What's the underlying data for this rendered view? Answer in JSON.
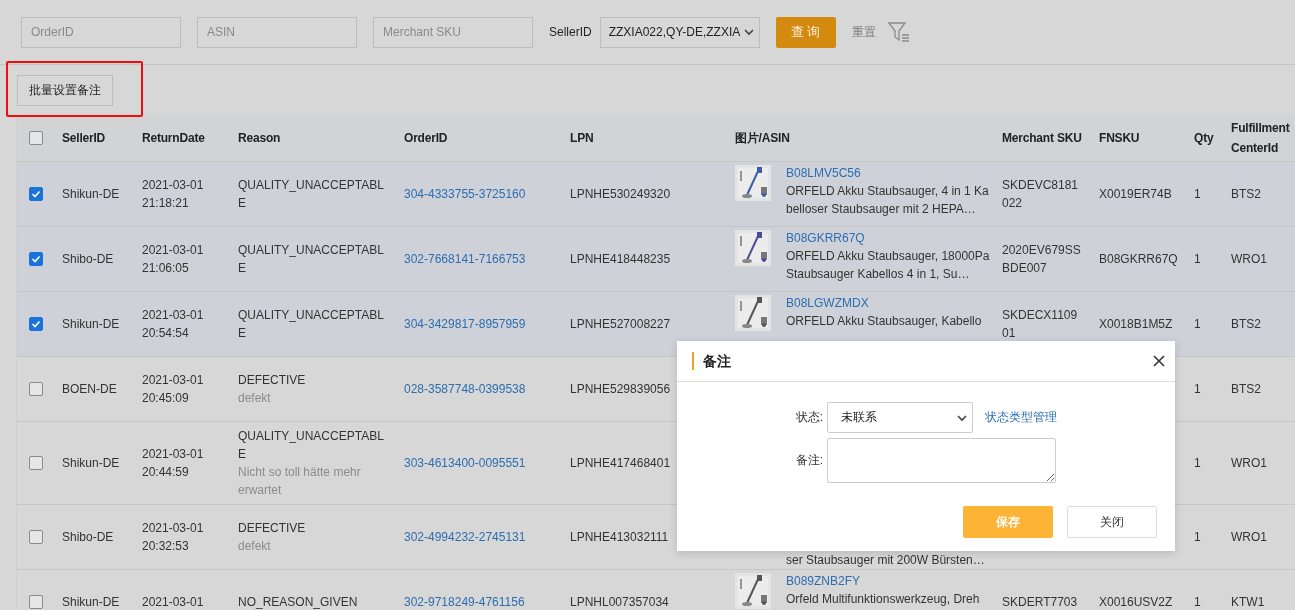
{
  "filters": {
    "fields": [
      {
        "placeholder": "OrderID"
      },
      {
        "placeholder": "ASIN"
      },
      {
        "placeholder": "Merchant SKU"
      }
    ],
    "seller_label": "SellerID",
    "seller_value": "ZZXIA022,QY-DE,ZZXIA",
    "search_button": "查 询",
    "reset_button": "重置"
  },
  "batch_button": "批量设置备注",
  "table": {
    "select_all": {
      "checked": false
    },
    "columns": [
      "SellerID",
      "ReturnDate",
      "Reason",
      "OrderID",
      "LPN",
      "图片/ASIN",
      "Merchant SKU",
      "FNSKU",
      "Qty",
      "Fulfillment CenterId"
    ],
    "rows": [
      {
        "checked": true,
        "seller_id": "Shikun-DE",
        "return_date": "2021-03-01 21:18:21",
        "reason": "QUALITY_UNACCEPTABLE",
        "order_id": "304-4333755-3725160",
        "lpn": "LPNHE530249320",
        "product": {
          "asin": "B08LMV5C56",
          "desc": "ORFELD Akku Staubsauger, 4 in 1 Kabelloser Staubsauger mit 2 HEPA…"
        },
        "merchant_sku": "SKDEVC8181022",
        "fnsku": "X0019ER74B",
        "qty": "1",
        "center": "BTS2"
      },
      {
        "checked": true,
        "seller_id": "Shibo-DE",
        "return_date": "2021-03-01 21:06:05",
        "reason": "QUALITY_UNACCEPTABLE",
        "order_id": "302-7668141-7166753",
        "lpn": "LPNHE418448235",
        "product": {
          "asin": "B08GKRR67Q",
          "desc": "ORFELD Akku Staubsauger, 18000Pa Staubsauger Kabellos 4 in 1, Su…"
        },
        "merchant_sku": "2020EV679SSBDE007",
        "fnsku": "B08GKRR67Q",
        "qty": "1",
        "center": "WRO1"
      },
      {
        "checked": true,
        "seller_id": "Shikun-DE",
        "return_date": "2021-03-01 20:54:54",
        "reason": "QUALITY_UNACCEPTABLE",
        "order_id": "304-3429817-8957959",
        "lpn": "LPNHE527008227",
        "product": {
          "asin": "B08LGWZMDX",
          "desc": "ORFELD Akku Staubsauger, Kabello"
        },
        "merchant_sku": "SKDECX110901",
        "fnsku": "X0018B1M5Z",
        "qty": "1",
        "center": "BTS2"
      },
      {
        "checked": false,
        "seller_id": "BOEN-DE",
        "return_date": "2021-03-01 20:45:09",
        "reason": "DEFECTIVE",
        "note": "defekt",
        "order_id": "028-3587748-0399538",
        "lpn": "LPNHE529839056",
        "qty": "1",
        "center": "BTS2"
      },
      {
        "checked": false,
        "seller_id": "Shikun-DE",
        "return_date": "2021-03-01 20:44:59",
        "reason": "QUALITY_UNACCEPTABLE",
        "note": "Nicht so toll hätte mehr erwartet",
        "order_id": "303-4613400-0095551",
        "lpn": "LPNHE417468401",
        "qty": "1",
        "center": "WRO1"
      },
      {
        "checked": false,
        "seller_id": "Shibo-DE",
        "return_date": "2021-03-01 20:32:53",
        "reason": "DEFECTIVE",
        "note": "defekt",
        "order_id": "302-4994232-2745131",
        "lpn": "LPNHE413032111",
        "product": {
          "desc": "ser Staubsauger mit 200W Bürsten…"
        },
        "qty": "1",
        "center": "WRO1"
      },
      {
        "checked": false,
        "seller_id": "Shikun-DE",
        "return_date": "2021-03-01",
        "reason": "NO_REASON_GIVEN",
        "order_id": "302-9718249-4761156",
        "lpn": "LPNHL007357034",
        "product": {
          "asin": "B089ZNB2FY",
          "desc": "Orfeld Multifunktionswerkzeug, Dreh"
        },
        "merchant_sku": "SKDERT7703",
        "fnsku": "X0016USV2Z",
        "qty": "1",
        "center": "KTW1"
      }
    ]
  },
  "dialog": {
    "title": "备注",
    "status_label": "状态:",
    "status_value": "未联系",
    "status_link": "状态类型管理",
    "note_label": "备注:",
    "save_button": "保存",
    "close_button": "关闭"
  }
}
